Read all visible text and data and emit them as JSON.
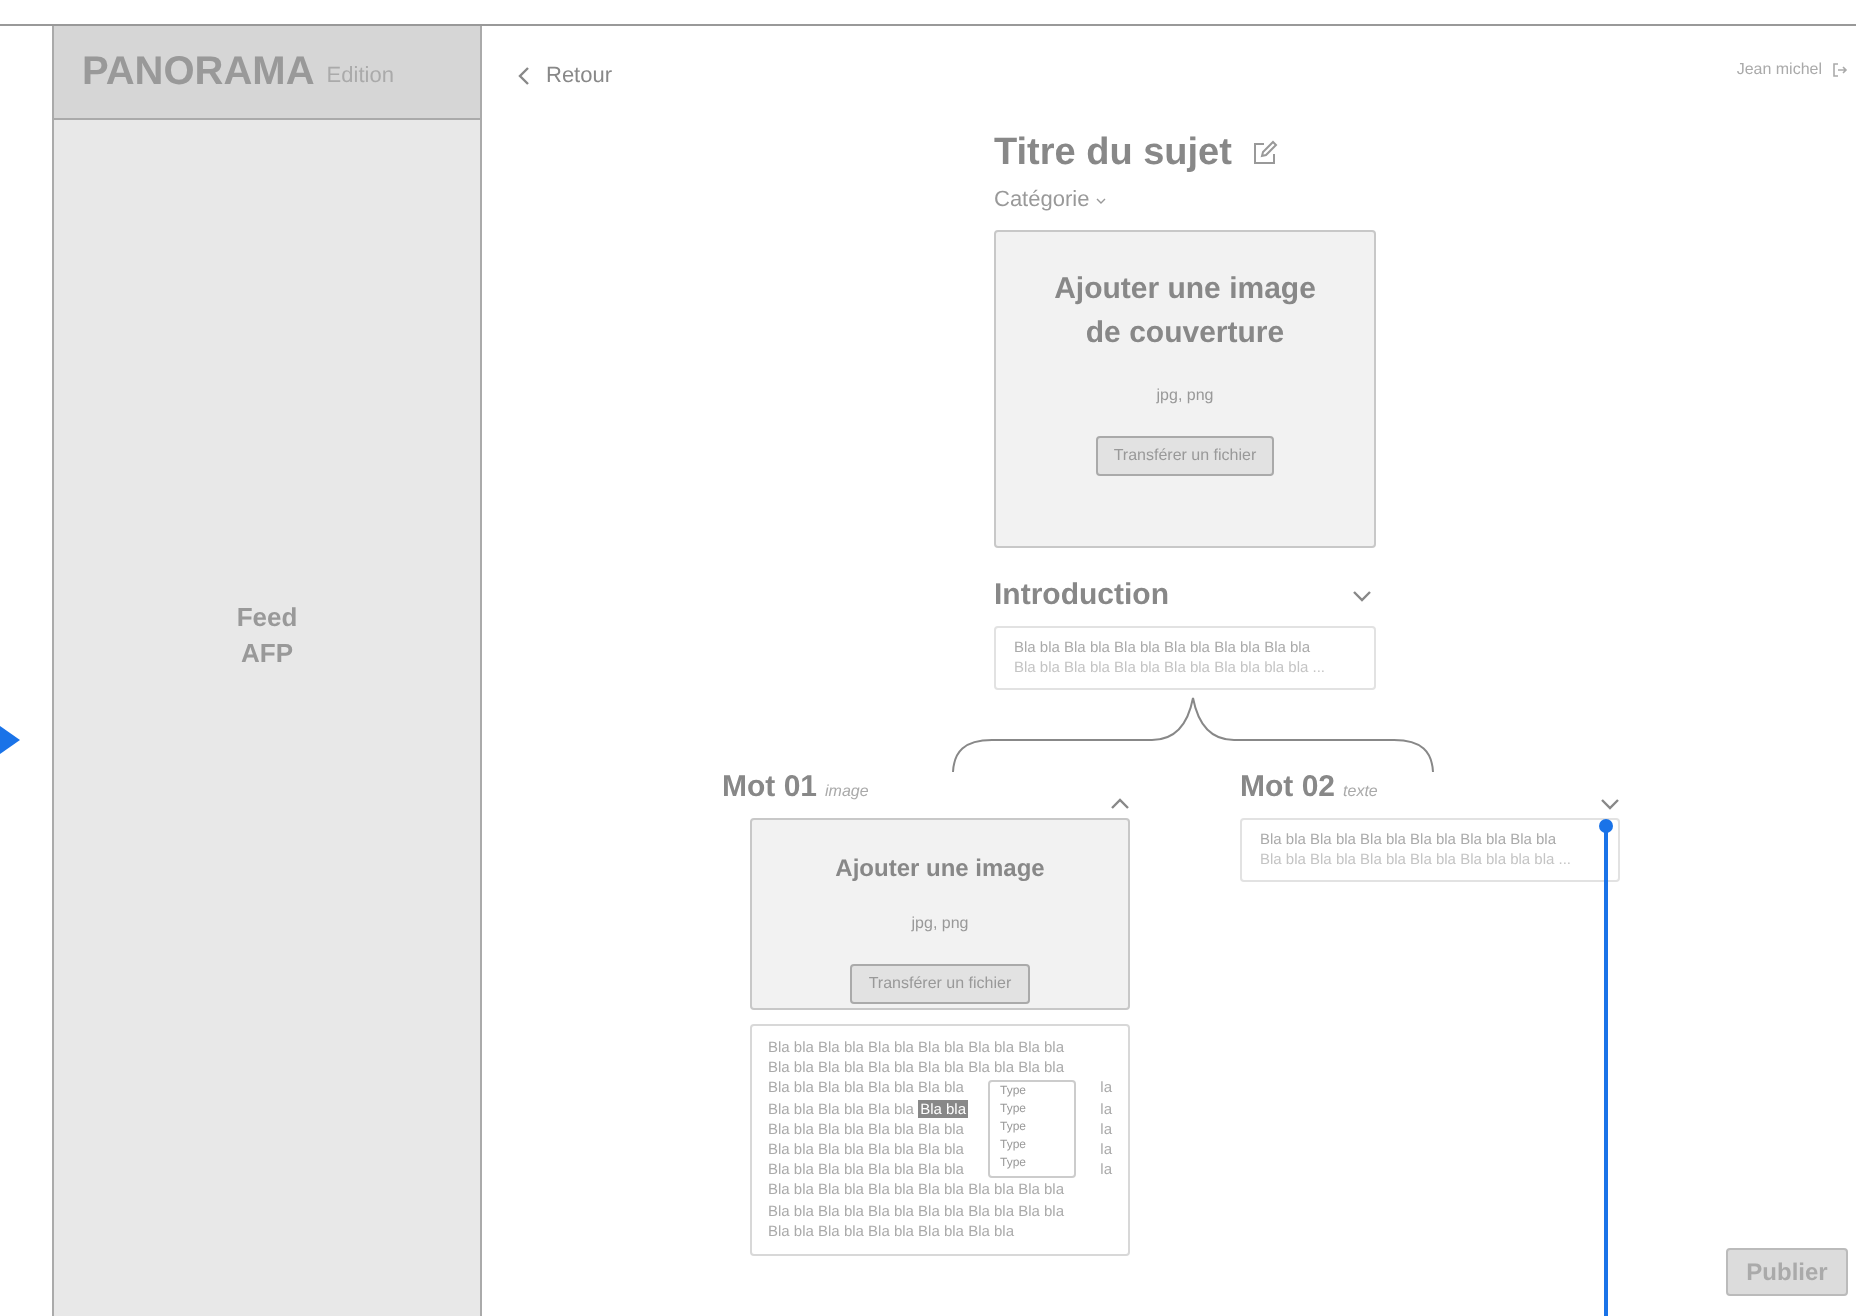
{
  "sidebar": {
    "logo": "PANORAMA",
    "edition": "Edition",
    "nav_item": [
      "Feed",
      "AFP"
    ]
  },
  "back_link": "Retour",
  "user": "Jean michel",
  "subject": {
    "title": "Titre du sujet",
    "category": "Catégorie"
  },
  "cover": {
    "title_lines": [
      "Ajouter une image",
      "de couverture"
    ],
    "formats": "jpg, png",
    "button": "Transférer un fichier"
  },
  "intro": {
    "title": "Introduction",
    "expanded": false,
    "preview": [
      "Bla bla Bla bla Bla bla Bla bla Bla bla Bla bla",
      "Bla bla Bla bla Bla bla Bla bla Bla bla bla bla ..."
    ]
  },
  "words": [
    {
      "kind": "image",
      "title": "Mot 01",
      "type": "image",
      "expanded": true,
      "upload": {
        "title": "Ajouter une image",
        "formats": "jpg, png",
        "button": "Transférer un fichier"
      },
      "body_lines": [
        {
          "text": "Bla bla Bla bla Bla bla Bla bla Bla bla Bla bla"
        },
        {
          "text": "Bla bla Bla bla Bla bla Bla bla Bla bla Bla bla"
        },
        {
          "text": "Bla bla Bla bla Bla bla Bla bla",
          "tail": "la"
        },
        {
          "text": "Bla bla Bla bla Bla bla",
          "selected_text": "Bla bla",
          "tail": "la"
        },
        {
          "text": "Bla bla Bla bla Bla bla Bla bla",
          "tail": "la"
        },
        {
          "text": "Bla bla Bla bla Bla bla Bla bla",
          "tail": "la"
        },
        {
          "text": "Bla bla Bla bla Bla bla Bla bla",
          "tail": "la"
        },
        {
          "text": "Bla bla Bla bla Bla bla Bla bla Bla bla Bla bla"
        },
        {
          "text": "Bla bla Bla bla Bla bla Bla bla Bla bla Bla bla"
        },
        {
          "text": "Bla bla Bla bla Bla bla Bla bla Bla bla"
        }
      ],
      "type_menu": [
        "Type",
        "Type",
        "Type",
        "Type",
        "Type"
      ]
    },
    {
      "kind": "text",
      "title": "Mot 02",
      "type": "texte",
      "expanded": false,
      "preview": [
        "Bla bla Bla bla Bla bla Bla bla Bla bla Bla bla",
        "Bla bla Bla bla Bla bla Bla bla Bla bla bla bla ..."
      ]
    }
  ],
  "publish_button": "Publier"
}
